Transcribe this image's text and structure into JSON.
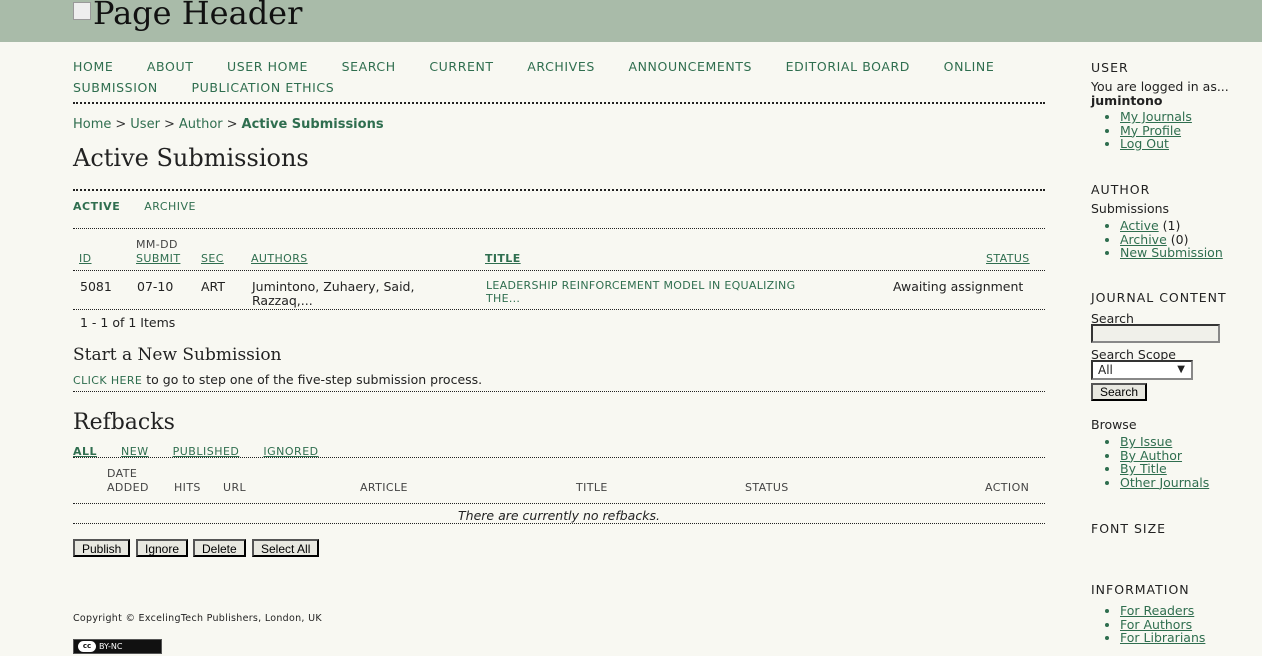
{
  "header": {
    "image_alt": "Page Header"
  },
  "nav": {
    "items": [
      "HOME",
      "ABOUT",
      "USER HOME",
      "SEARCH",
      "CURRENT",
      "ARCHIVES",
      "ANNOUNCEMENTS",
      "EDITORIAL BOARD",
      "ONLINE SUBMISSION",
      "PUBLICATION ETHICS"
    ]
  },
  "breadcrumb": {
    "home": "Home",
    "user": "User",
    "author": "Author",
    "current": "Active Submissions",
    "sep": ">"
  },
  "page_title": "Active Submissions",
  "tabs": {
    "active": "ACTIVE",
    "archive": "ARCHIVE"
  },
  "submissions_table": {
    "headers": {
      "id": "ID",
      "mmdd": "MM-DD",
      "submit": "SUBMIT",
      "sec": "SEC",
      "authors": "AUTHORS",
      "title": "TITLE",
      "status": "STATUS"
    },
    "rows": [
      {
        "id": "5081",
        "date": "07-10",
        "sec": "ART",
        "authors_1": "Jumintono, Zuhaery, Said,",
        "authors_2": "Razzaq,...",
        "title_1": "LEADERSHIP REINFORCEMENT MODEL IN EQUALIZING",
        "title_2": "THE...",
        "status": "Awaiting assignment"
      }
    ],
    "pagination": "1 - 1 of 1 Items"
  },
  "new_submission": {
    "title": "Start a New Submission",
    "link": "CLICK HERE",
    "text": " to go to step one of the five-step submission process."
  },
  "refbacks": {
    "title": "Refbacks",
    "filters": [
      "ALL",
      "NEW",
      "PUBLISHED",
      "IGNORED"
    ],
    "headers": {
      "date": "DATE",
      "added": "ADDED",
      "hits": "HITS",
      "url": "URL",
      "article": "ARTICLE",
      "title": "TITLE",
      "status": "STATUS",
      "action": "ACTION"
    },
    "empty": "There are currently no refbacks.",
    "buttons": {
      "publish": "Publish",
      "ignore": "Ignore",
      "delete": "Delete",
      "select_all": "Select All"
    }
  },
  "footer": {
    "copyright": "Copyright © ExcelingTech Publishers, London, UK",
    "badge": "BY-NC",
    "badge_cc": "cc"
  },
  "sidebar": {
    "user": {
      "title": "USER",
      "logged_in": "You are logged in as...",
      "username": "jumintono",
      "links": [
        "My Journals",
        "My Profile",
        "Log Out"
      ]
    },
    "author": {
      "title": "AUTHOR",
      "subtitle": "Submissions",
      "active": "Active",
      "active_count": "(1)",
      "archive": "Archive",
      "archive_count": "(0)",
      "new": "New Submission"
    },
    "journal_content": {
      "title": "JOURNAL CONTENT",
      "search_label": "Search",
      "scope_label": "Search Scope",
      "scope_value": "All",
      "search_button": "Search",
      "browse": "Browse",
      "browse_links": [
        "By Issue",
        "By Author",
        "By Title",
        "Other Journals"
      ]
    },
    "font_size": {
      "title": "FONT SIZE"
    },
    "information": {
      "title": "INFORMATION",
      "links": [
        "For Readers",
        "For Authors",
        "For Librarians"
      ]
    }
  }
}
